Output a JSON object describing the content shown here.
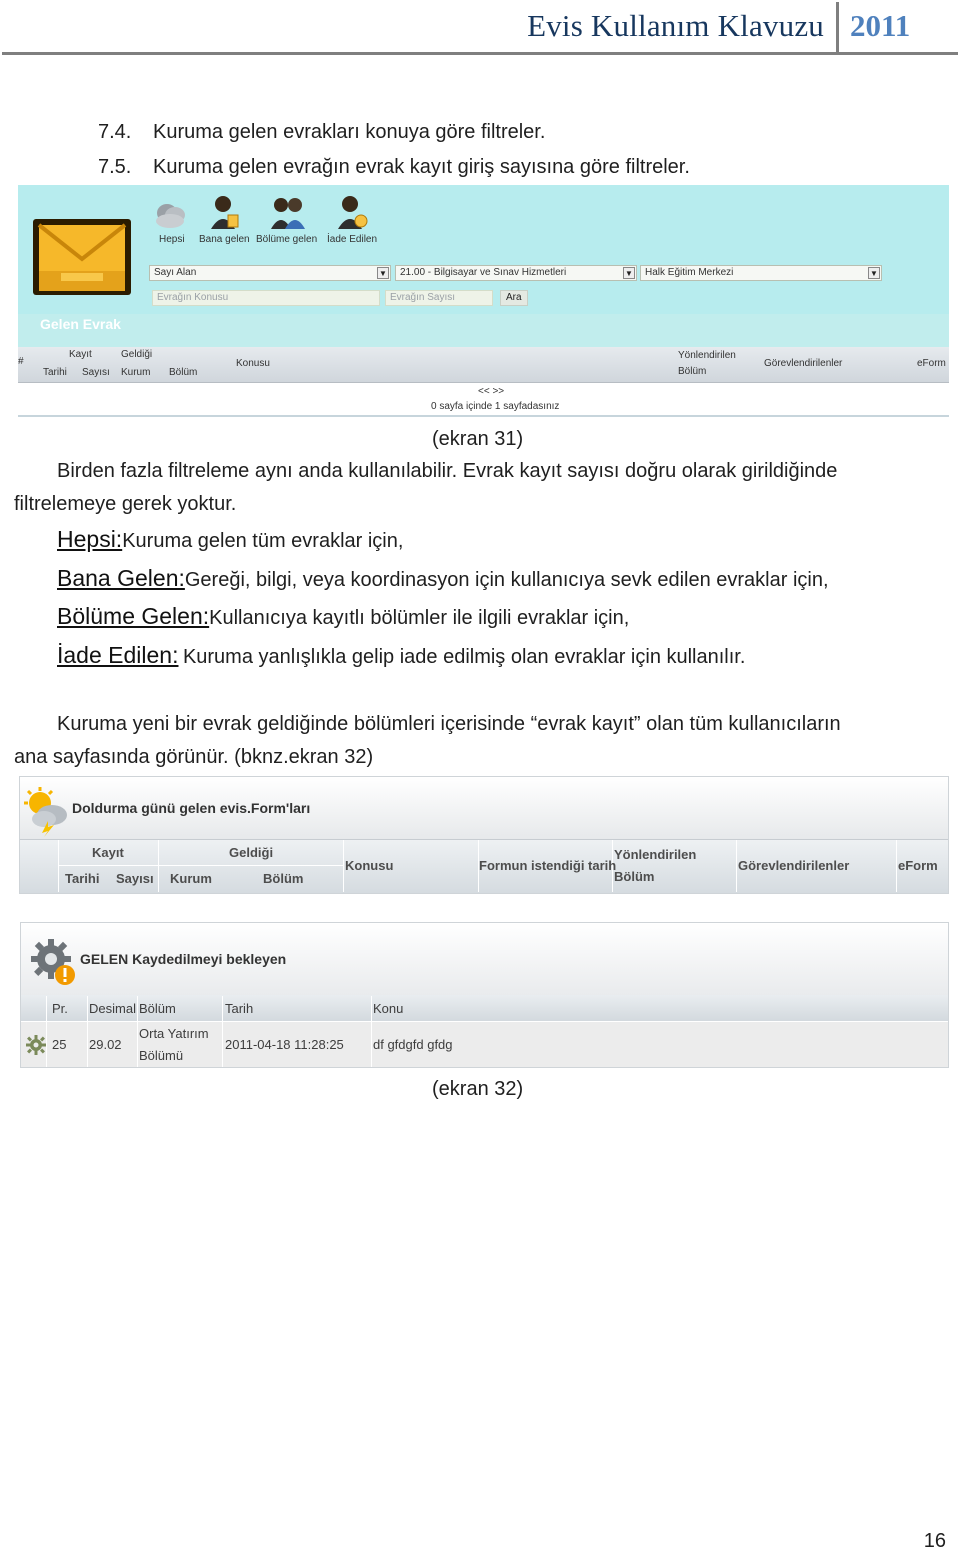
{
  "header": {
    "title": "Evis Kullanım Klavuzu",
    "year": "2011"
  },
  "list_items": [
    {
      "num": "7.4.",
      "text": "Kuruma gelen evrakları konuya göre filtreler."
    },
    {
      "num": "7.5.",
      "text": "Kuruma gelen evrağın evrak kayıt giriş sayısına göre filtreler."
    }
  ],
  "screen31": {
    "panel_title": "Gelen Evrak",
    "tabs": [
      "Hepsi",
      "Bana gelen",
      "Bölüme gelen",
      "İade Edilen"
    ],
    "selects": [
      "Sayı Alan",
      "21.00 - Bilgisayar ve Sınav Hizmetleri",
      "Halk Eğitim Merkezi"
    ],
    "inputs": [
      "Evrağın Konusu",
      "Evrağın Sayısı"
    ],
    "search_button": "Ara",
    "columns": {
      "hash": "#",
      "kayit": "Kayıt",
      "geldigi": "Geldiği",
      "tarihi": "Tarihi",
      "sayisi": "Sayısı",
      "kurum": "Kurum",
      "bolum": "Bölüm",
      "konusu": "Konusu",
      "yonlendirilen": "Yönlendirilen",
      "yonlendirilen_bolum": "Bölüm",
      "gorevlendirilenler": "Görevlendirilenler",
      "eform": "eForm"
    },
    "pager_nav": "<< >>",
    "pager_text": "0 sayfa içinde 1 sayfadasınız"
  },
  "caption31": "(ekran 31)",
  "para1": {
    "line1": "Birden fazla filtreleme aynı anda kullanılabilir. Evrak kayıt sayısı doğru olarak girildiğinde",
    "line2": "filtrelemeye gerek yoktur."
  },
  "definitions": [
    {
      "term": "Hepsi:",
      "desc": "Kuruma gelen tüm evraklar için,"
    },
    {
      "term": "Bana Gelen:",
      "desc": "Gereği, bilgi, veya koordinasyon için kullanıcıya sevk edilen evraklar için,"
    },
    {
      "term": "Bölüme Gelen:",
      "desc": "Kullanıcıya kayıtlı bölümler ile ilgili evraklar için,"
    },
    {
      "term": "İade Edilen:",
      "desc": "Kuruma yanlışlıkla gelip iade edilmiş olan evraklar için kullanılır."
    }
  ],
  "para2": {
    "line1": "Kuruma yeni bir evrak geldiğinde bölümleri içerisinde “evrak kayıt” olan tüm kullanıcıların",
    "line2": "ana sayfasında görünür. (bknz.ekran 32)"
  },
  "screen32a": {
    "title": "Doldurma günü gelen evis.Form'ları",
    "columns": {
      "kayit": "Kayıt",
      "geldigi": "Geldiği",
      "tarihi": "Tarihi",
      "sayisi": "Sayısı",
      "kurum": "Kurum",
      "bolum": "Bölüm",
      "konusu": "Konusu",
      "formun": "Formun istendiği tarih",
      "yonlendirilen": "Yönlendirilen",
      "yonlendirilen_bolum": "Bölüm",
      "gorevlendirilenler": "Görevlendirilenler",
      "eform": "eForm"
    }
  },
  "screen32b": {
    "title": "GELEN Kaydedilmeyi bekleyen",
    "columns": [
      "Pr.",
      "Desimal",
      "Bölüm",
      "Tarih",
      "Konu"
    ],
    "row": {
      "pr": "25",
      "desimal": "29.02",
      "bolum_line1": "Orta Yatırım",
      "bolum_line2": "Bölümü",
      "tarih": "2011-04-18 11:28:25",
      "konu": "df gfdgfd gfdg"
    }
  },
  "caption32": "(ekran 32)",
  "page_number": "16"
}
